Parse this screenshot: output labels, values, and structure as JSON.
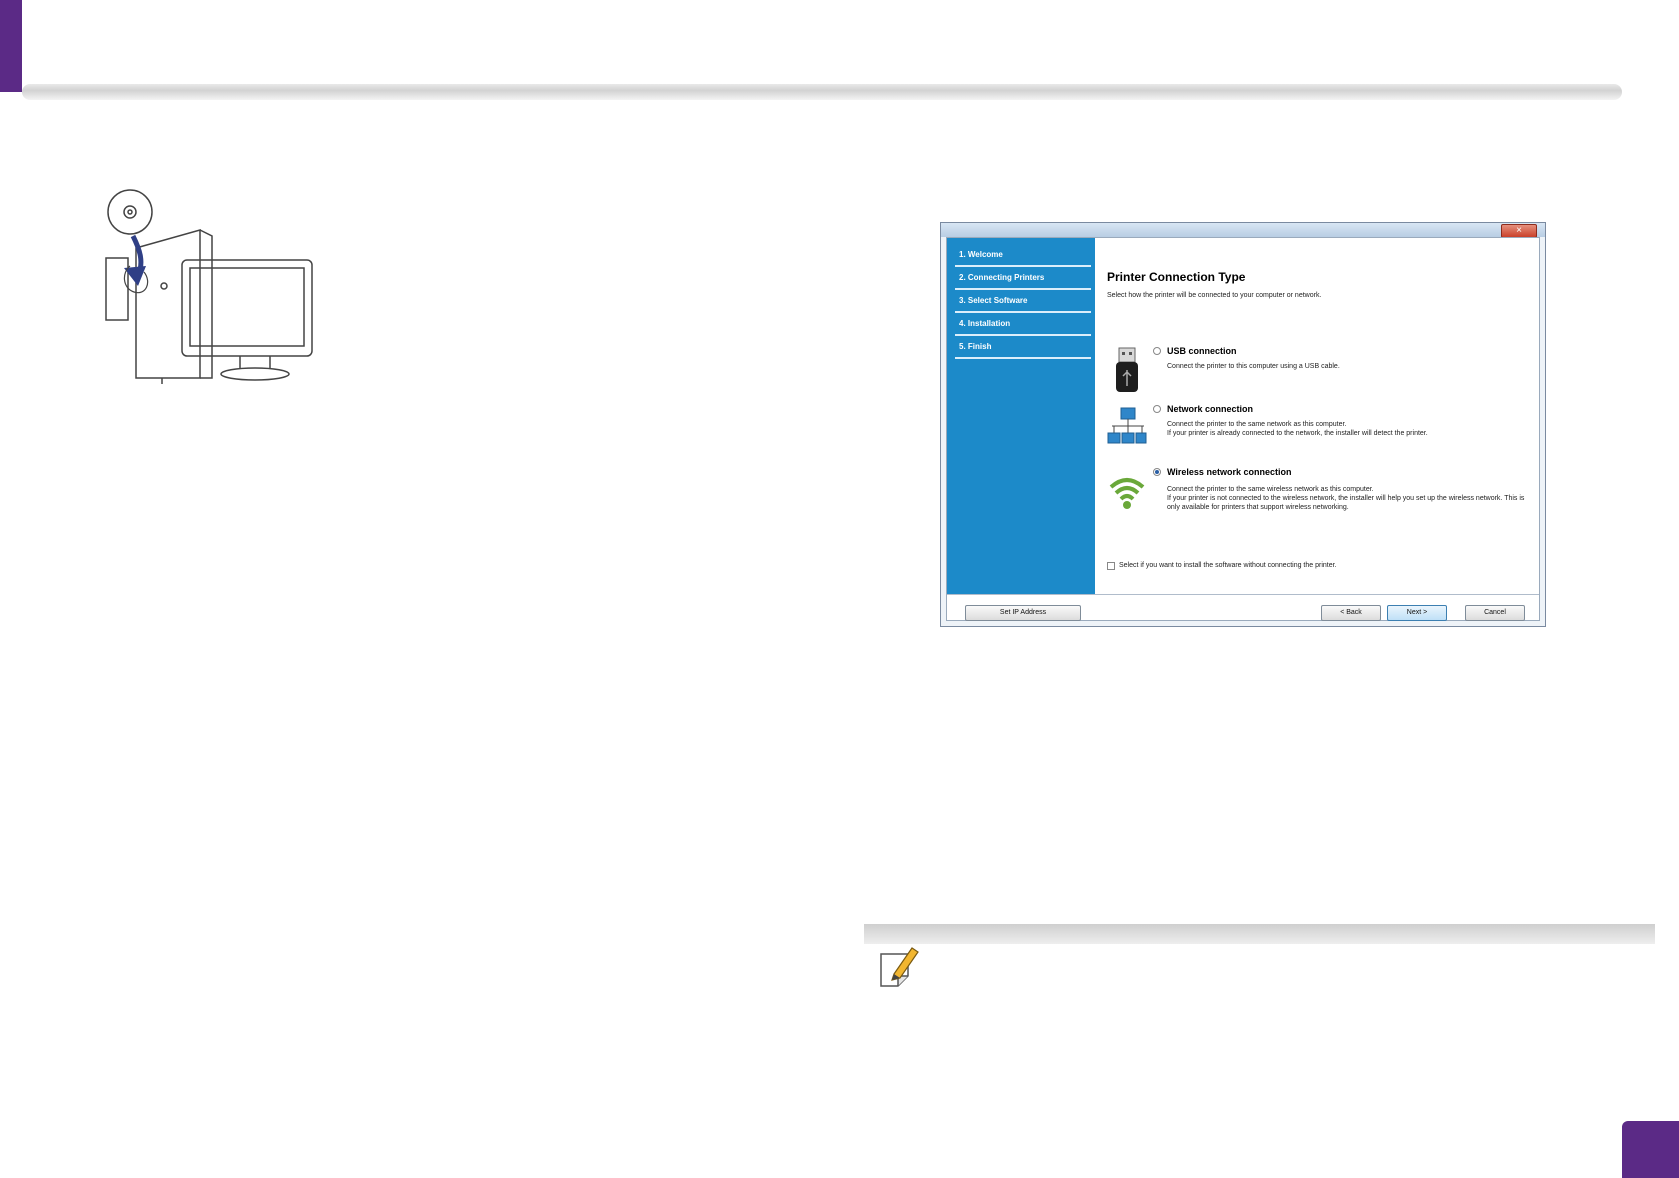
{
  "dialog": {
    "close_label": "×",
    "steps": [
      {
        "label": "1. Welcome"
      },
      {
        "label": "2. Connecting Printers"
      },
      {
        "label": "3. Select Software"
      },
      {
        "label": "4. Installation"
      },
      {
        "label": "5. Finish"
      }
    ],
    "title": "Printer Connection Type",
    "subtitle": "Select how the printer will be connected to your computer or network.",
    "options": [
      {
        "icon": "usb-icon",
        "label": "USB connection",
        "description": "Connect the printer to this computer using a USB cable.",
        "selected": false
      },
      {
        "icon": "network-icon",
        "label": "Network connection",
        "description": "Connect the printer to the same network as this computer.\nIf your printer is already connected to the network, the installer will detect the printer.",
        "selected": false
      },
      {
        "icon": "wireless-icon",
        "label": "Wireless network connection",
        "description": "Connect the printer to the same wireless network as this computer.\nIf your printer is not connected to the wireless network, the installer will help you set up the wireless network. This is only available for printers that support wireless networking.",
        "selected": true
      }
    ],
    "checkbox_label": "Select if you want to install the software without connecting the printer.",
    "buttons": {
      "set_ip": "Set IP Address",
      "back": "< Back",
      "next": "Next >",
      "cancel": "Cancel"
    }
  },
  "colors": {
    "accent": "#5b2a86",
    "step_panel": "#1c8ac9"
  }
}
